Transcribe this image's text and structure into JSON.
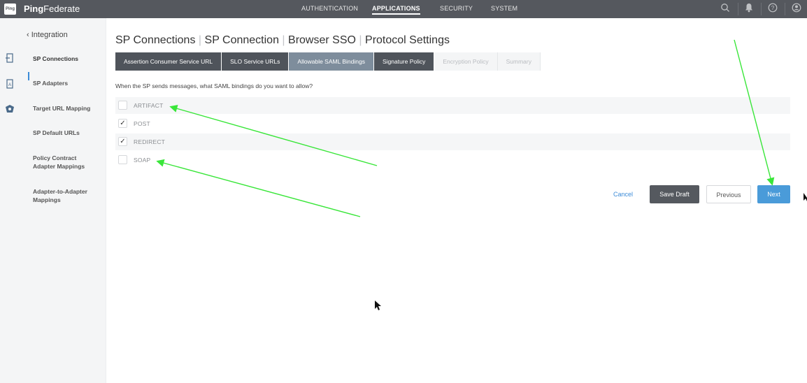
{
  "app": {
    "logo_text": "Ping",
    "brand_bold": "Ping",
    "brand_rest": "Federate"
  },
  "topnav": {
    "items": [
      {
        "label": "AUTHENTICATION"
      },
      {
        "label": "APPLICATIONS"
      },
      {
        "label": "SECURITY"
      },
      {
        "label": "SYSTEM"
      }
    ],
    "active": "APPLICATIONS"
  },
  "sidebar": {
    "back_label": "Integration",
    "items": [
      {
        "label": "SP Connections"
      },
      {
        "label": "SP Adapters"
      },
      {
        "label": "Target URL Mapping"
      },
      {
        "label": "SP Default URLs"
      },
      {
        "label": "Policy Contract Adapter Mappings"
      },
      {
        "label": "Adapter-to-Adapter Mappings"
      }
    ],
    "active": "SP Connections"
  },
  "page": {
    "breadcrumb": [
      "SP Connections",
      "SP Connection",
      "Browser SSO",
      "Protocol Settings"
    ],
    "question": "When the SP sends messages, what SAML bindings do you want to allow?"
  },
  "tabs": [
    {
      "label": "Assertion Consumer Service URL",
      "state": "done"
    },
    {
      "label": "SLO Service URLs",
      "state": "done"
    },
    {
      "label": "Allowable SAML Bindings",
      "state": "current"
    },
    {
      "label": "Signature Policy",
      "state": "done"
    },
    {
      "label": "Encryption Policy",
      "state": "disabled"
    },
    {
      "label": "Summary",
      "state": "disabled"
    }
  ],
  "bindings": [
    {
      "label": "ARTIFACT",
      "checked": false
    },
    {
      "label": "POST",
      "checked": true
    },
    {
      "label": "REDIRECT",
      "checked": true
    },
    {
      "label": "SOAP",
      "checked": false
    }
  ],
  "actions": {
    "cancel": "Cancel",
    "save_draft": "Save Draft",
    "previous": "Previous",
    "next": "Next"
  },
  "colors": {
    "topbar": "#55585e",
    "tab_done": "#4f545b",
    "tab_current": "#7e8d9c",
    "accent": "#4a9bd9",
    "annotation_arrow": "#39e639"
  },
  "icons": {
    "search": "search-icon",
    "bell": "bell-icon",
    "help": "help-icon",
    "user": "user-icon",
    "cursor": "cursor-icon"
  }
}
